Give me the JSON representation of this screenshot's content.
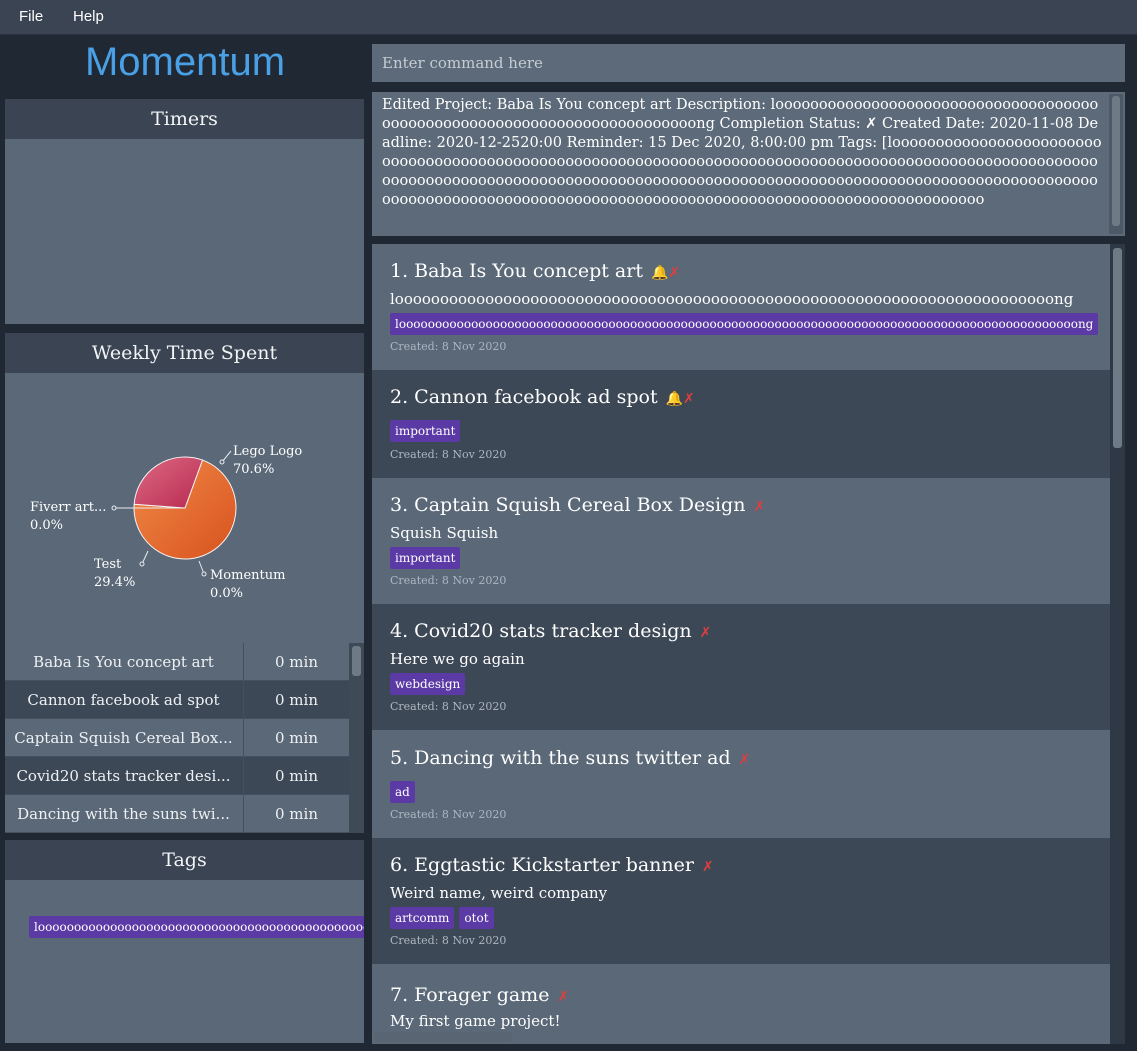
{
  "menu": {
    "file": "File",
    "help": "Help"
  },
  "app_title": "Momentum",
  "timers": {
    "title": "Timers"
  },
  "weekly": {
    "title": "Weekly Time Spent",
    "pie": [
      {
        "name": "Lego Logo",
        "pct": "70.6%",
        "value": 70.6,
        "color": "#e8622a"
      },
      {
        "name": "Test",
        "pct": "29.4%",
        "value": 29.4,
        "color": "#c43a5e"
      },
      {
        "name": "Momentum",
        "pct": "0.0%",
        "value": 0.0,
        "color": "#aaaaaa"
      },
      {
        "name": "Fiverr art...",
        "pct": "0.0%",
        "value": 0.0,
        "color": "#aaaaaa"
      }
    ],
    "rows": [
      {
        "name": "Baba Is You concept art",
        "time": "0 min"
      },
      {
        "name": "Cannon facebook ad spot",
        "time": "0 min"
      },
      {
        "name": "Captain Squish Cereal Box...",
        "time": "0 min"
      },
      {
        "name": "Covid20 stats tracker desi...",
        "time": "0 min"
      },
      {
        "name": "Dancing with the suns twi...",
        "time": "0 min"
      }
    ]
  },
  "tags_panel": {
    "title": "Tags",
    "tag": "loooooooooooooooooooooooooooooooooooooooooooooooong"
  },
  "command": {
    "placeholder": "Enter command here"
  },
  "result": {
    "text": "Edited Project: Baba Is You concept art Description: looooooooooooooooooooooooooooooooooooooooooooooooooooooooooooooooooooooooong Completion Status: ✗ Created Date: 2020-11-08 Deadline: 2020-12-2520:00 Reminder: 15 Dec 2020, 8:00:00 pm Tags: [looooooooooooooooooooooooooooooooooooooooooooooooooooooooooooooooooooooooooooooooooooooooooooooooooooooooooooooooooooooooooooooooooooooooooooooooooooooooooooooooooooooooooooooooooooooooooooooooooooooooooooooooooooooooooooooooooooooooooooooooooooooooooooooooo"
  },
  "projects": [
    {
      "title": "1. Baba Is You concept art",
      "bell": "🔔",
      "cross": "✗",
      "desc": "looooooooooooooooooooooooooooooooooooooooooooooooooooooooooooooooooooooooong",
      "tags": [
        "loooooooooooooooooooooooooooooooooooooooooooooooooooooooooooooooooooooooooooooooooooooooooooooong"
      ],
      "created": "Created: 8 Nov 2020"
    },
    {
      "title": "2. Cannon facebook ad spot",
      "bell": "🔔",
      "cross": "✗",
      "desc": "",
      "tags": [
        "important"
      ],
      "created": "Created: 8 Nov 2020"
    },
    {
      "title": "3. Captain Squish Cereal Box Design",
      "bell": "",
      "cross": "✗",
      "desc": "Squish Squish",
      "tags": [
        "important"
      ],
      "created": "Created: 8 Nov 2020"
    },
    {
      "title": "4. Covid20 stats tracker design",
      "bell": "",
      "cross": "✗",
      "desc": "Here we go again",
      "tags": [
        "webdesign"
      ],
      "created": "Created: 8 Nov 2020"
    },
    {
      "title": "5. Dancing with the suns twitter ad",
      "bell": "",
      "cross": "✗",
      "desc": "",
      "tags": [
        "ad"
      ],
      "created": "Created: 8 Nov 2020"
    },
    {
      "title": "6. Eggtastic Kickstarter banner",
      "bell": "",
      "cross": "✗",
      "desc": "Weird name, weird company",
      "tags": [
        "artcomm",
        "otot"
      ],
      "created": "Created: 8 Nov 2020"
    },
    {
      "title": "7. Forager game",
      "bell": "",
      "cross": "✗",
      "desc": "My first game project!",
      "tags": [],
      "created": ""
    }
  ]
}
